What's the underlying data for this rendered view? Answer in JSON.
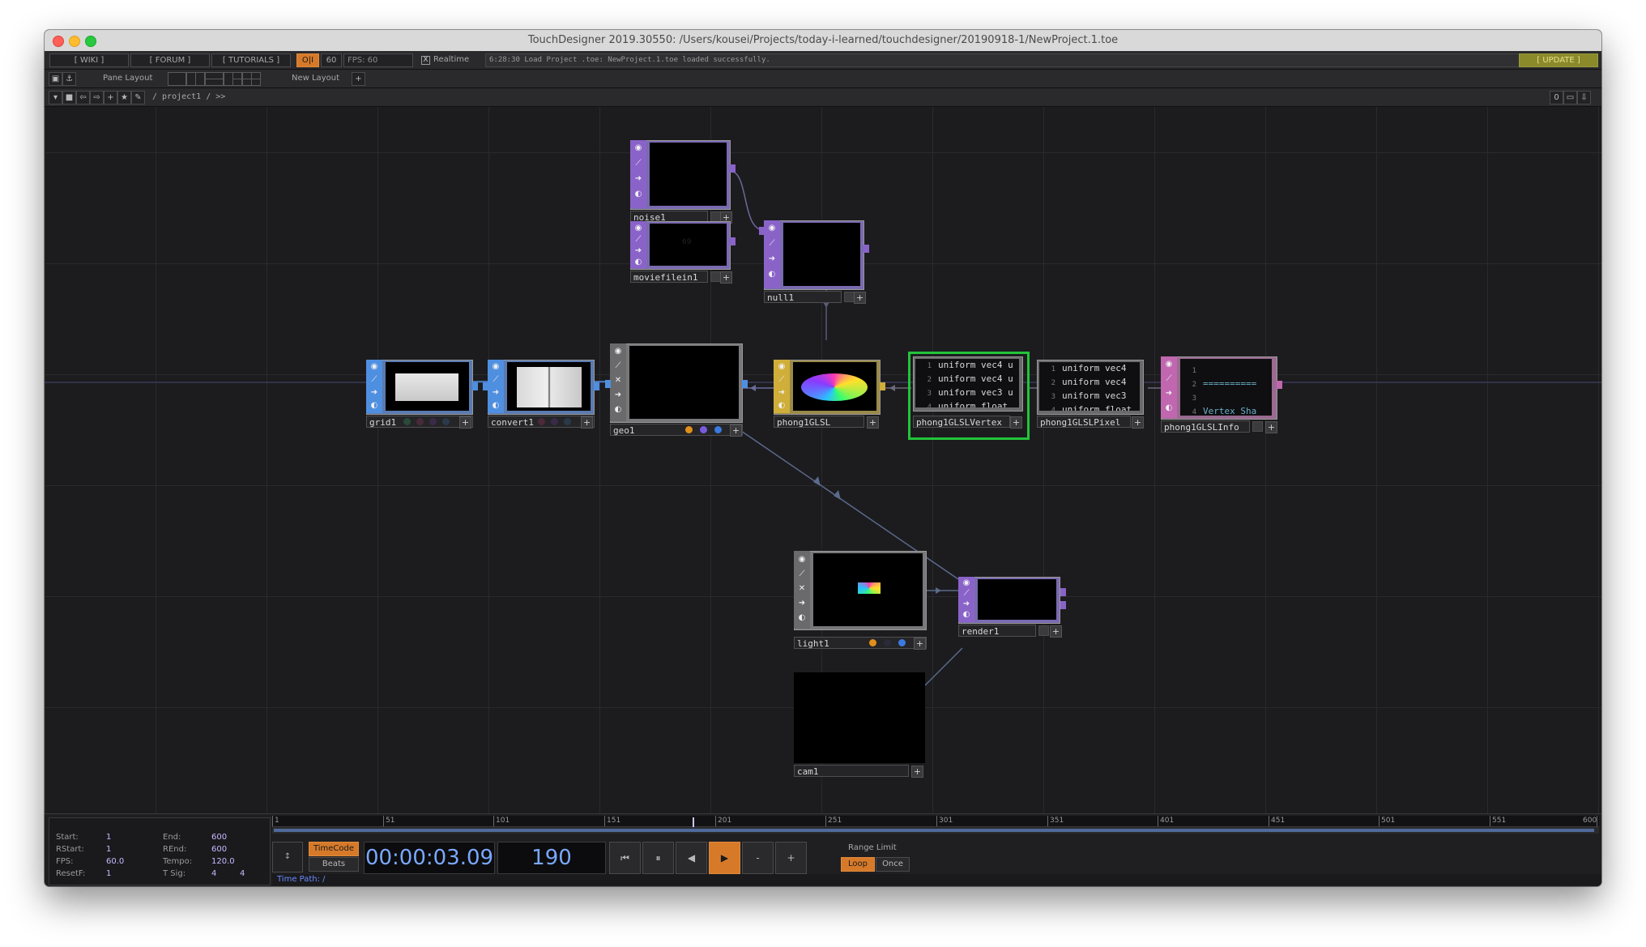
{
  "window": {
    "title": "TouchDesigner 2019.30550: /Users/kousei/Projects/today-i-learned/touchdesigner/20190918-1/NewProject.1.toe"
  },
  "toolbar": {
    "wiki": "[ WIKI ]",
    "forum": "[ FORUM ]",
    "tutorials": "[ TUTORIALS ]",
    "oi": "O|I",
    "sixty": "60",
    "fps": "FPS:  60",
    "realtime_check": "X",
    "realtime": "Realtime",
    "status": "6:28:30 Load Project .toe: NewProject.1.toe loaded successfully.",
    "update": "[ UPDATE ]"
  },
  "panebar": {
    "pane_layout": "Pane Layout",
    "new_layout": "New Layout",
    "add": "+"
  },
  "pathbar": {
    "path": "/  project1  /  >>",
    "count": "0"
  },
  "nodes": {
    "noise1": "noise1",
    "moviefilein1": "moviefilein1",
    "movie_frame": "69",
    "null1": "null1",
    "grid1": "grid1",
    "convert1": "convert1",
    "geo1": "geo1",
    "phong1GLSL": "phong1GLSL",
    "phong1GLSLVertex": "phong1GLSLVertex",
    "phong1GLSLPixel": "phong1GLSLPixel",
    "phong1GLSLInfo": "phong1GLSLInfo",
    "light1": "light1",
    "render1": "render1",
    "cam1": "cam1"
  },
  "code": {
    "vertex": [
      {
        "n": "1",
        "t": "uniform vec4 u"
      },
      {
        "n": "2",
        "t": "uniform vec4 u"
      },
      {
        "n": "3",
        "t": "uniform vec3 u"
      },
      {
        "n": "4",
        "t": "uniform float"
      }
    ],
    "pixel": [
      {
        "n": "1",
        "t": "uniform vec4"
      },
      {
        "n": "2",
        "t": "uniform vec4"
      },
      {
        "n": "3",
        "t": "uniform vec3"
      },
      {
        "n": "4",
        "t": "uniform float"
      }
    ],
    "info": [
      {
        "n": "1",
        "t": ""
      },
      {
        "n": "2",
        "t": "=========="
      },
      {
        "n": "3",
        "t": ""
      },
      {
        "n": "4",
        "t": "Vertex Sha"
      }
    ]
  },
  "range": {
    "start_label": "Start:",
    "start": "1",
    "end_label": "End:",
    "end": "600",
    "rstart_label": "RStart:",
    "rstart": "1",
    "rend_label": "REnd:",
    "rend": "600",
    "fps_label": "FPS:",
    "fps": "60.0",
    "tempo_label": "Tempo:",
    "tempo": "120.0",
    "resetf_label": "ResetF:",
    "resetf": "1",
    "tsig_label": "T Sig:",
    "tsig_a": "4",
    "tsig_b": "4"
  },
  "timeline": {
    "ticks": [
      "1",
      "51",
      "101",
      "151",
      "201",
      "251",
      "301",
      "351",
      "401",
      "451",
      "501",
      "551",
      "600"
    ],
    "current_frame_fraction": 0.3167,
    "timecode_btn": "TimeCode",
    "beats_btn": "Beats",
    "timecode": "00:00:03.09",
    "frame": "190",
    "range_limit": "Range Limit",
    "loop": "Loop",
    "once": "Once",
    "time_path": "Time Path: /",
    "rewind": "⏮",
    "pause": "⏸",
    "step_back": "◀",
    "play": "▶",
    "minus": "-",
    "plus": "+"
  },
  "colors": {
    "top": "#8a63c9",
    "sop": "#4f8fe0",
    "comp": "#7a7a7c",
    "mat": "#cfae39",
    "dat": "#c067b0",
    "selected": "#22c43a"
  }
}
